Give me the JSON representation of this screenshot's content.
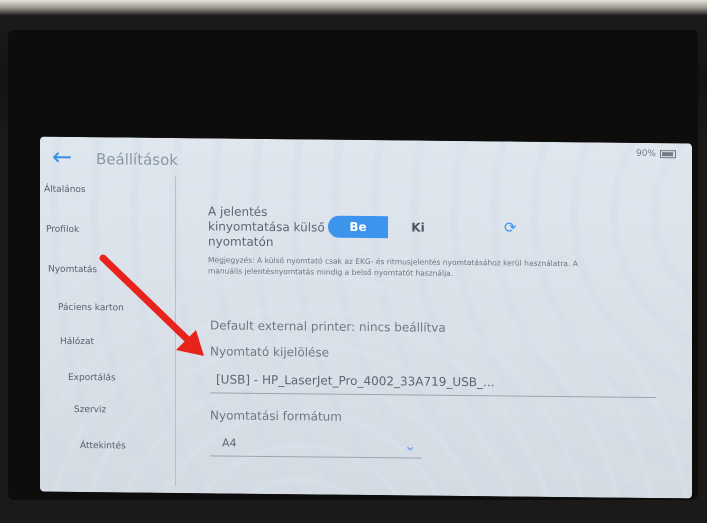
{
  "screen": {
    "title": "Beállítások",
    "battery_text": "90%",
    "icons": {
      "back": "back-arrow-icon",
      "battery": "battery-icon",
      "refresh": "refresh-icon",
      "dropdown": "chevron-down-icon"
    },
    "accent_color": "#3d94ec"
  },
  "sidebar": {
    "items": [
      {
        "label": "Általános"
      },
      {
        "label": "Profilok"
      },
      {
        "label": "Nyomtatás"
      },
      {
        "label": "Páciens karton"
      },
      {
        "label": "Hálózat"
      },
      {
        "label": "Exportálás"
      },
      {
        "label": "Szerviz"
      },
      {
        "label": "Áttekintés"
      }
    ]
  },
  "settings": {
    "external_print_label": "A jelentés kinyomtatása külső nyomtatón",
    "toggle_on": "Be",
    "toggle_off": "Ki",
    "toggle_selected": "Be",
    "description": "Megjegyzés: A külső nyomtató csak az EKG- és ritmusjelentés nyomtatásához kerül használatra. A manuális jelentésnyomtatás mindig a belső nyomtatót használja.",
    "default_printer": "Default external printer: nincs beállítva",
    "printer_select_label": "Nyomtató kijelölése",
    "printer_select_value": "[USB] - HP_LaserJet_Pro_4002_33A719_USB_...",
    "format_label": "Nyomtatási formátum",
    "format_value": "A4"
  },
  "annotation": {
    "arrow_color": "#e8231c"
  }
}
